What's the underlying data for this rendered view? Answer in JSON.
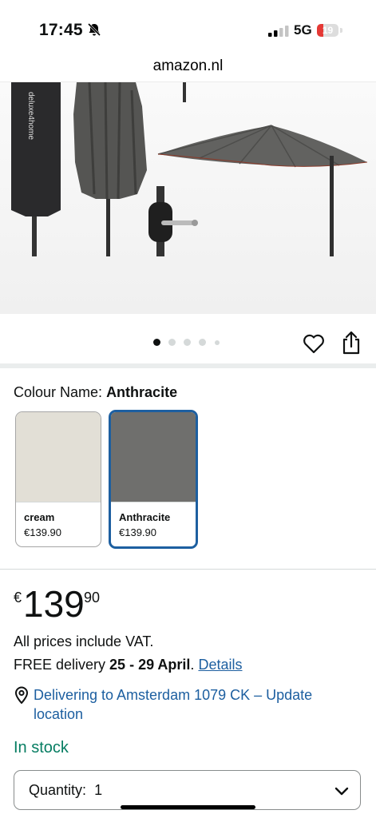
{
  "status_bar": {
    "time": "17:45",
    "network": "5G",
    "battery": "19"
  },
  "browser": {
    "url": "amazon.nl"
  },
  "gallery": {
    "brand_text": "deluxe4home",
    "image_count": 5,
    "active_index": 0
  },
  "colour": {
    "label": "Colour Name:",
    "selected": "Anthracite",
    "options": [
      {
        "name": "cream",
        "price": "€139.90",
        "swatch_color": "#e2dfd6"
      },
      {
        "name": "Anthracite",
        "price": "€139.90",
        "swatch_color": "#6f6f6d"
      }
    ]
  },
  "price": {
    "currency": "€",
    "whole": "139",
    "fraction": "90"
  },
  "vat_note": "All prices include VAT.",
  "delivery": {
    "prefix": "FREE delivery",
    "dates": "25 - 29 April",
    "suffix": ".",
    "details_link": "Details"
  },
  "location": {
    "text": "Delivering to Amsterdam 1079 CK – Update location"
  },
  "stock": {
    "status": "In stock",
    "color": "#067d62"
  },
  "quantity": {
    "label": "Quantity:",
    "value": "1"
  },
  "accent_colors": {
    "link": "#1d5fa0",
    "selected_border": "#1d5fa0"
  }
}
